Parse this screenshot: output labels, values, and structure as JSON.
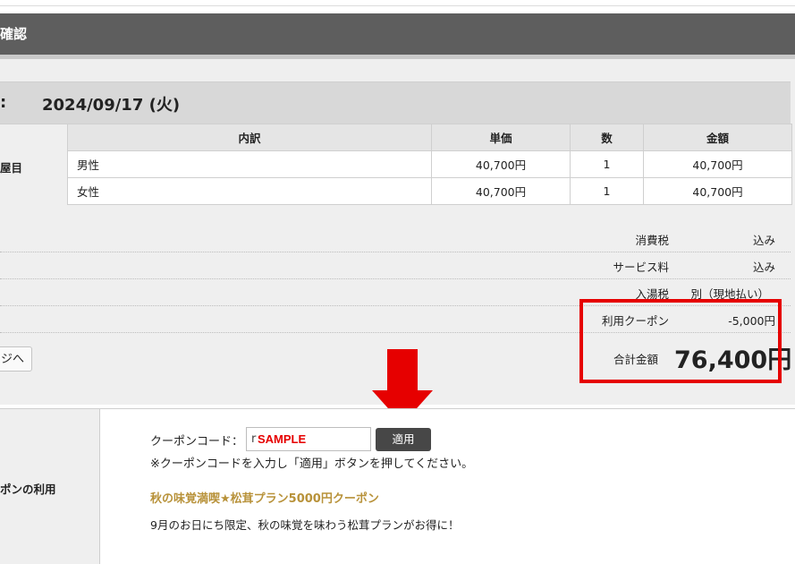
{
  "header": {
    "title": "確認"
  },
  "booking": {
    "date_colon": ":",
    "date": "2024/09/17 (火)"
  },
  "table": {
    "row_label": "屋目",
    "headers": [
      "内訳",
      "単価",
      "数",
      "金額"
    ],
    "rows": [
      {
        "name": "男性",
        "price": "40,700円",
        "qty": "1",
        "amount": "40,700円"
      },
      {
        "name": "女性",
        "price": "40,700円",
        "qty": "1",
        "amount": "40,700円"
      }
    ]
  },
  "summary": {
    "tax_label": "消費税",
    "tax_value": "込み",
    "service_label": "サービス料",
    "service_value": "込み",
    "bath_label": "入湯税",
    "bath_value": "別（現地払い）",
    "coupon_label": "利用クーポン",
    "coupon_value": "-5,000円",
    "total_label": "合計金額",
    "total_value": "76,400円"
  },
  "back_button": "ジへ",
  "coupon": {
    "section_label": "ポンの利用",
    "code_label": "クーポンコード：",
    "input_value": "r",
    "watermark": "SAMPLE",
    "apply_label": "適用",
    "note": "※クーポンコードを入力し「適用」ボタンを押してください。",
    "plan_title": "秋の味覚満喫★松茸プラン5000円クーポン",
    "plan_desc": "9月のお日にち限定、秋の味覚を味わう松茸プランがお得に！"
  },
  "colors": {
    "highlight": "#e60000",
    "header_bg": "#5e5e5e",
    "plan_title": "#b8923a"
  }
}
